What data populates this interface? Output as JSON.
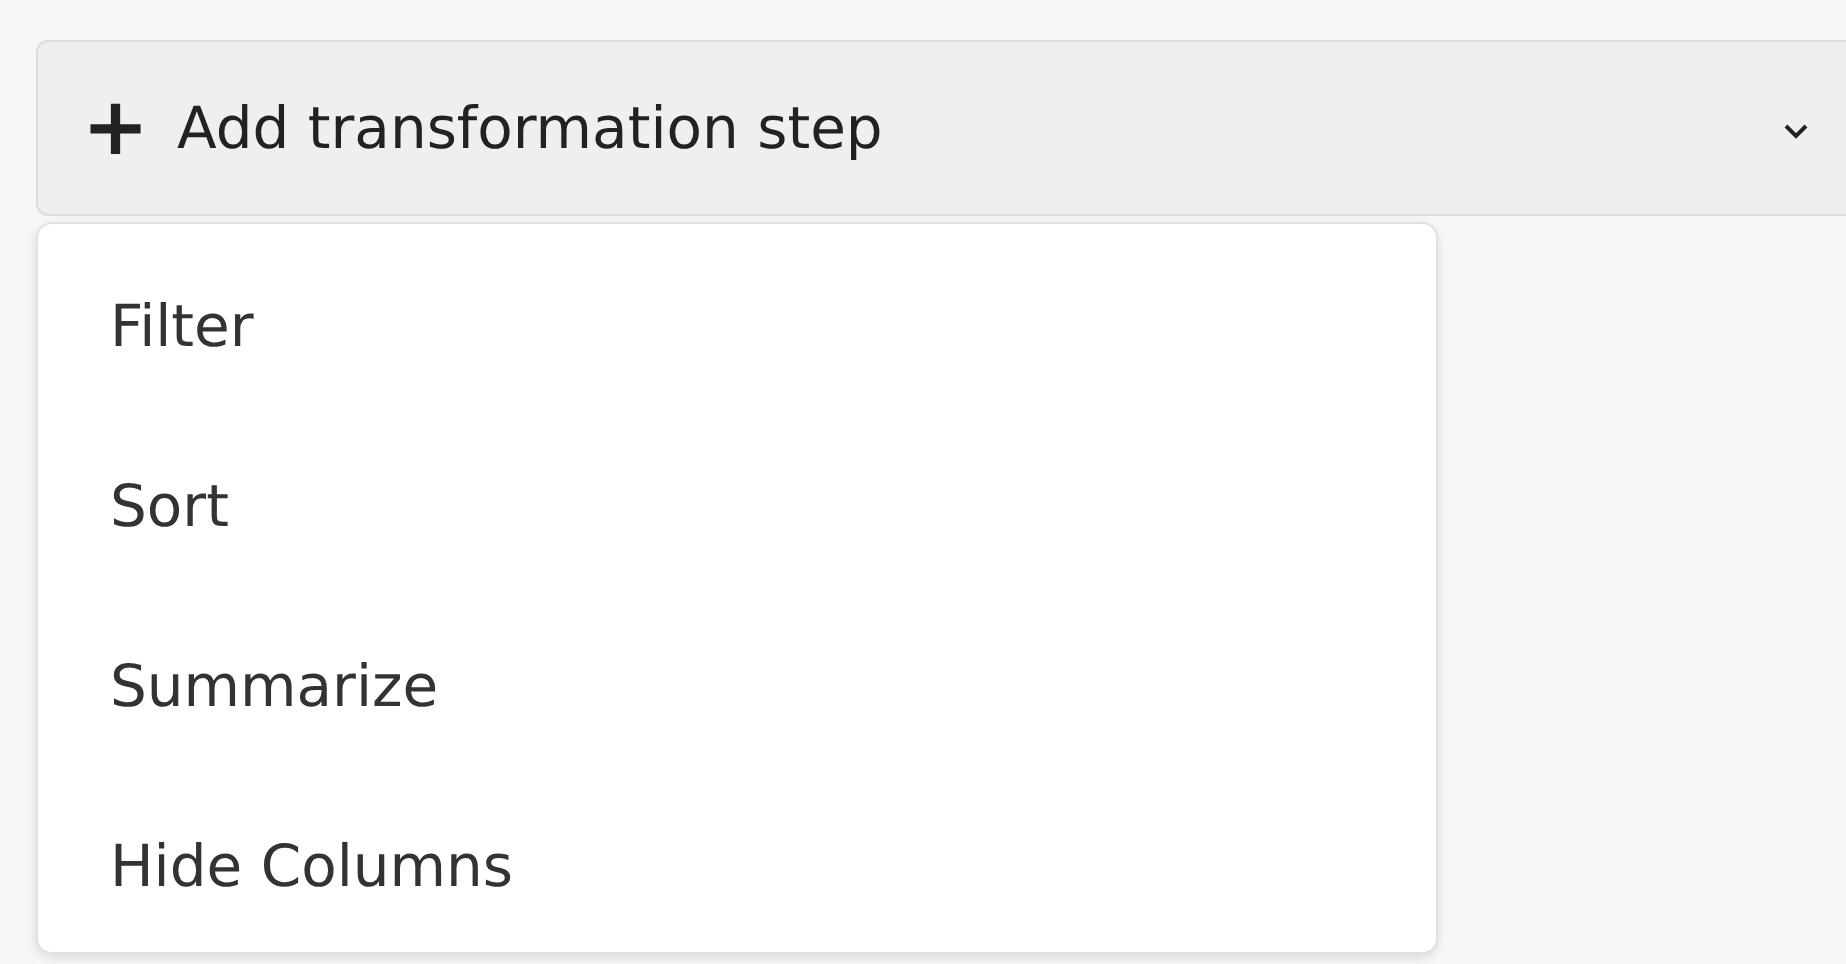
{
  "add_step_button": {
    "icon": "+",
    "label": "Add transformation step",
    "expanded": true
  },
  "menu_items": [
    {
      "label": "Filter"
    },
    {
      "label": "Sort"
    },
    {
      "label": "Summarize"
    },
    {
      "label": "Hide Columns"
    }
  ]
}
